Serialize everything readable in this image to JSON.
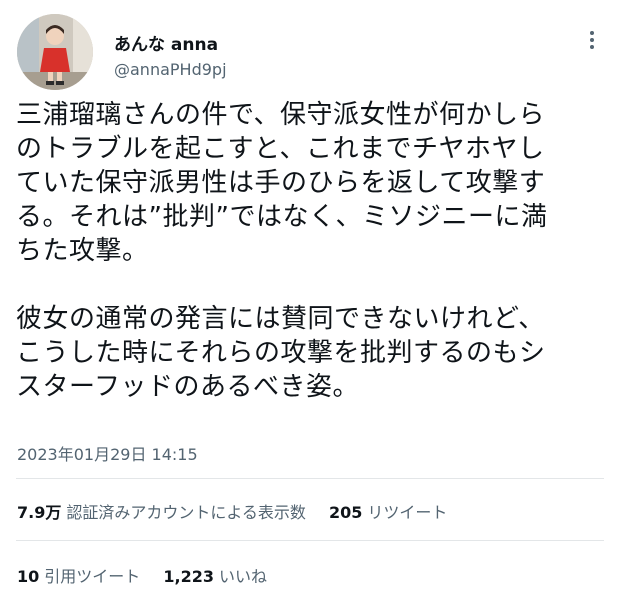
{
  "author": {
    "display_name": "あんな anna",
    "handle": "@annaPHd9pj",
    "avatar_icon": "avatar-photo"
  },
  "more_icon": "more-vertical-icon",
  "tweet": {
    "text": "三浦瑠璃さんの件で、保守派女性が何かしら\nのトラブルを起こすと、これまでチヤホヤし\nていた保守派男性は手のひらを返して攻撃す\nる。それは”批判”ではなく、ミソジニーに満\nちた攻撃。\n\n彼女の通常の発言には賛同できないけれど、\nこうした時にそれらの攻撃を批判するのもシ\nスターフッドのあるべき姿。",
    "timestamp": "2023年01月29日 14:15"
  },
  "stats": {
    "views_count": "7.9万",
    "views_label": "認証済みアカウントによる表示数",
    "retweets_count": "205",
    "retweets_label": "リツイート",
    "quotes_count": "10",
    "quotes_label": "引用ツイート",
    "likes_count": "1,223",
    "likes_label": "いいね"
  },
  "colors": {
    "text": "#0f1419",
    "secondary": "#536471",
    "divider": "#e3e6e8"
  }
}
